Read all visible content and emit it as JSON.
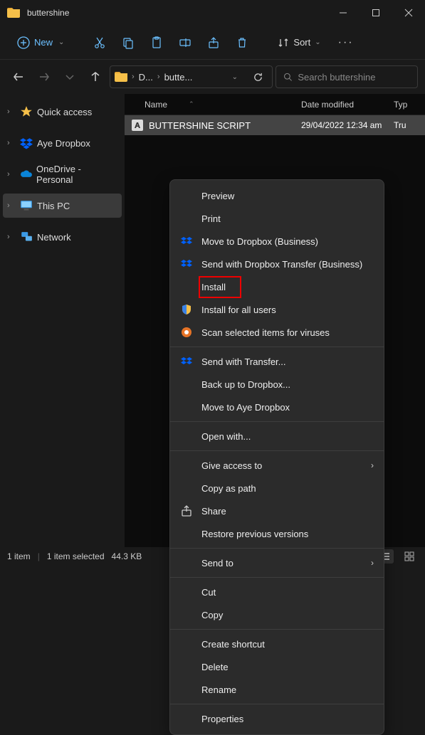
{
  "window": {
    "title": "buttershine"
  },
  "toolbar": {
    "new_label": "New",
    "sort_label": "Sort"
  },
  "breadcrumb": {
    "parts": [
      "D...",
      "butte..."
    ]
  },
  "search": {
    "placeholder": "Search buttershine"
  },
  "tree": {
    "quick_access": "Quick access",
    "aye_dropbox": "Aye Dropbox",
    "onedrive": "OneDrive - Personal",
    "this_pc": "This PC",
    "network": "Network"
  },
  "columns": {
    "name": "Name",
    "date": "Date modified",
    "type": "Typ"
  },
  "file": {
    "name": "BUTTERSHINE SCRIPT",
    "date": "29/04/2022 12:34 am",
    "type": "Tru"
  },
  "context": {
    "preview": "Preview",
    "print": "Print",
    "move_dropbox_biz": "Move to Dropbox (Business)",
    "send_dropbox_transfer": "Send with Dropbox Transfer (Business)",
    "install": "Install",
    "install_all": "Install for all users",
    "scan": "Scan selected items for viruses",
    "send_transfer": "Send with Transfer...",
    "backup_dropbox": "Back up to Dropbox...",
    "move_aye": "Move to Aye Dropbox",
    "open_with": "Open with...",
    "give_access": "Give access to",
    "copy_path": "Copy as path",
    "share": "Share",
    "restore": "Restore previous versions",
    "send_to": "Send to",
    "cut": "Cut",
    "copy": "Copy",
    "create_shortcut": "Create shortcut",
    "delete": "Delete",
    "rename": "Rename",
    "properties": "Properties"
  },
  "status": {
    "count": "1 item",
    "selection": "1 item selected",
    "size": "44.3 KB"
  }
}
